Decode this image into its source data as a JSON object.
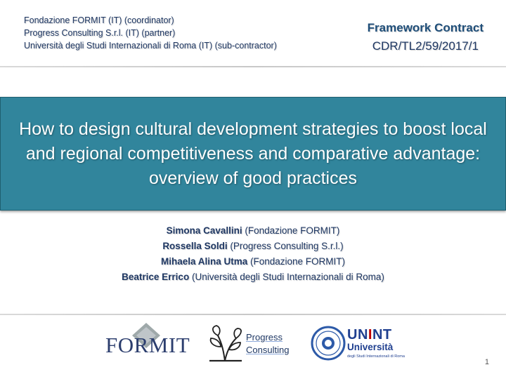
{
  "header": {
    "partners": [
      "Fondazione FORMIT (IT) (coordinator)",
      "Progress Consulting S.r.l. (IT) (partner)",
      "Università degli Studi Internazionali di Roma (IT) (sub-contractor)"
    ],
    "contract_label": "Framework Contract",
    "contract_code": "CDR/TL2/59/2017/1"
  },
  "title": "How to design cultural development strategies to boost local and regional competitiveness and comparative advantage: overview of good practices",
  "authors": [
    {
      "name": "Simona Cavallini",
      "affiliation": "(Fondazione FORMIT)"
    },
    {
      "name": "Rossella Soldi",
      "affiliation": "(Progress Consulting S.r.l.)"
    },
    {
      "name": "Mihaela Alina Utma",
      "affiliation": "(Fondazione FORMIT)"
    },
    {
      "name": "Beatrice Errico",
      "affiliation": "(Università degli Studi Internazionali di Roma)"
    }
  ],
  "logos": {
    "formit": "FORMIT",
    "progress_line1": "Progress",
    "progress_line2": "Consulting",
    "unint_acronym": "UNINT",
    "unint_word": "Università",
    "unint_sub": "degli Studi Internazionali di Roma"
  },
  "colors": {
    "title_bg": "#31859c",
    "text_dark_blue": "#1f3864",
    "accent_red": "#c00000"
  },
  "page_number": "1"
}
